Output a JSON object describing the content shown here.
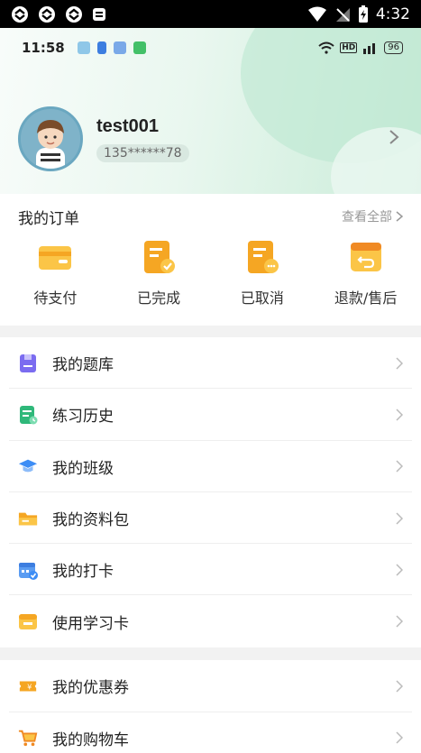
{
  "system_status": {
    "time": "4:32"
  },
  "inner_status": {
    "time": "11:58",
    "battery": "96"
  },
  "profile": {
    "username": "test001",
    "phone": "135******78"
  },
  "orders": {
    "title": "我的订单",
    "view_all": "查看全部",
    "items": [
      {
        "label": "待支付",
        "icon": "wallet-icon"
      },
      {
        "label": "已完成",
        "icon": "completed-doc-icon"
      },
      {
        "label": "已取消",
        "icon": "cancelled-doc-icon"
      },
      {
        "label": "退款/售后",
        "icon": "refund-box-icon"
      }
    ]
  },
  "menu": {
    "items": [
      {
        "label": "我的题库",
        "icon": "question-bank-icon"
      },
      {
        "label": "练习历史",
        "icon": "practice-history-icon"
      },
      {
        "label": "我的班级",
        "icon": "graduation-cap-icon"
      },
      {
        "label": "我的资料包",
        "icon": "folder-icon"
      },
      {
        "label": "我的打卡",
        "icon": "calendar-check-icon"
      },
      {
        "label": "使用学习卡",
        "icon": "study-card-icon"
      }
    ],
    "items2": [
      {
        "label": "我的优惠券",
        "icon": "coupon-icon"
      },
      {
        "label": "我的购物车",
        "icon": "shopping-cart-icon"
      }
    ]
  },
  "colors": {
    "accent_orange": "#f5a623",
    "header_green": "#c9ecd8",
    "purple": "#7b6cf0",
    "green": "#2fb87a",
    "blue": "#3d8df5"
  }
}
